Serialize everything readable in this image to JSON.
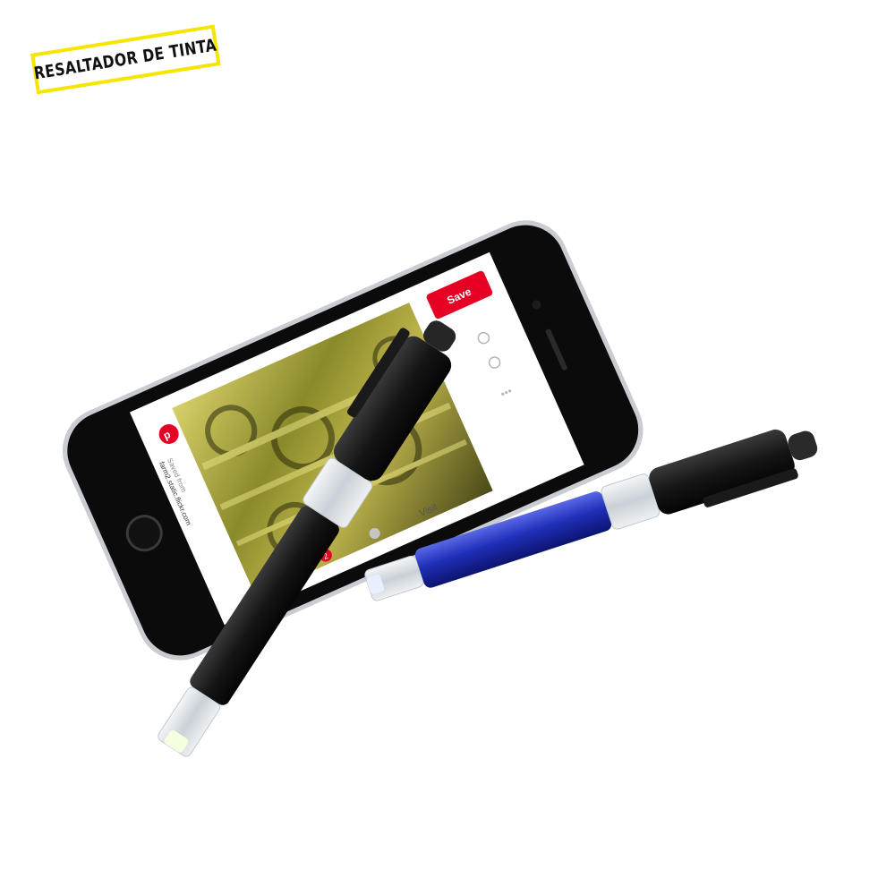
{
  "badge": {
    "label": "RESALTADOR DE TINTA",
    "border_color": "#f4e600"
  },
  "phone": {
    "screen": {
      "saved_from_label": "Saved from",
      "source_site": "farm2.static.flickr.com",
      "save_button_label": "Save",
      "visit_label": "Visit",
      "notification_count": "2",
      "accent_color": "#e60023"
    }
  },
  "pens": [
    {
      "name": "black-highlighter-pen",
      "barrel_color": "#141414"
    },
    {
      "name": "blue-highlighter-pen",
      "barrel_color": "#1f2fb8"
    }
  ]
}
